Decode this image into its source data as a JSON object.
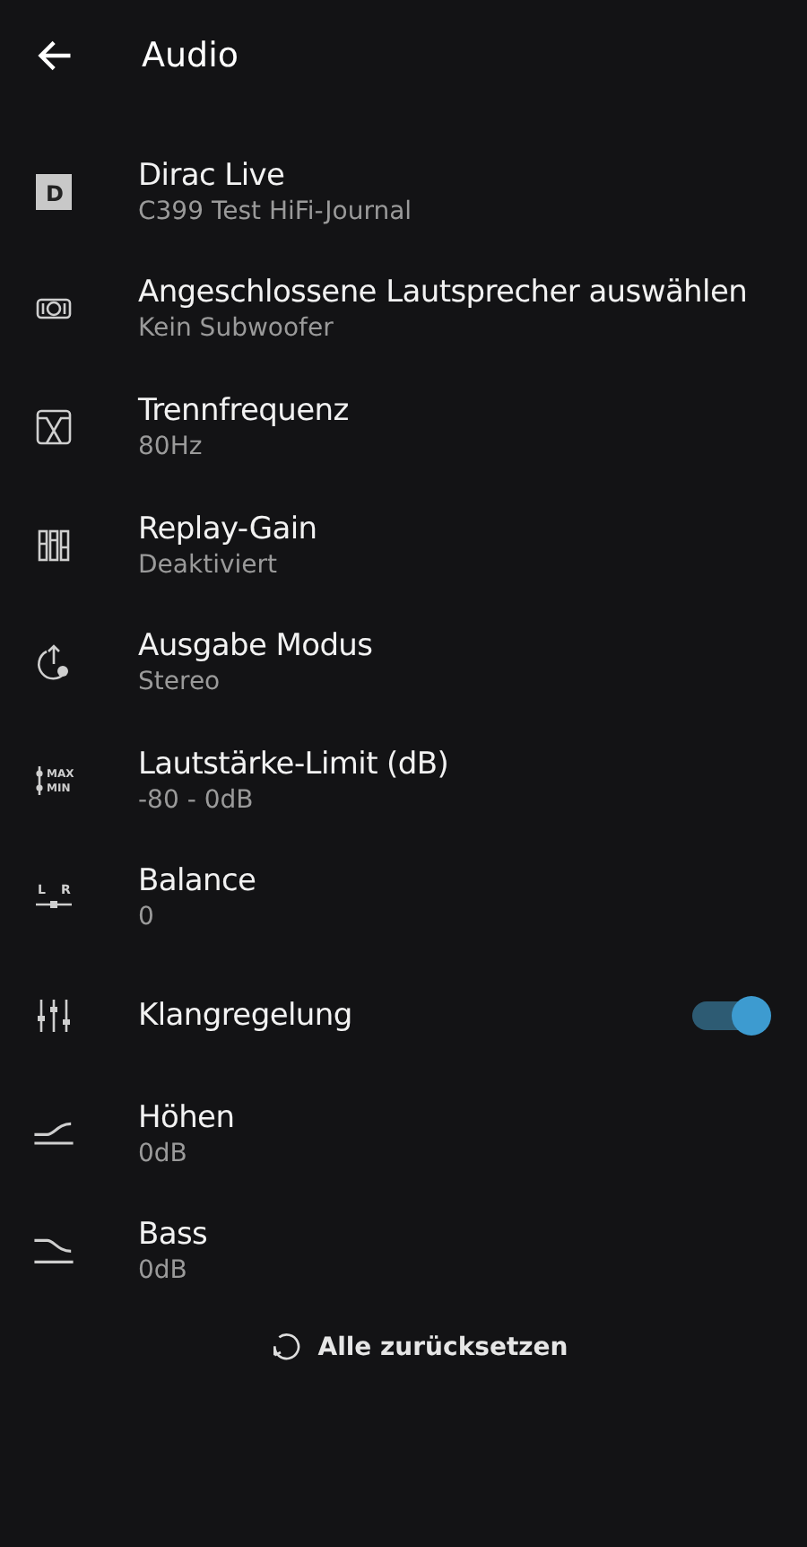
{
  "header": {
    "title": "Audio"
  },
  "items": [
    {
      "kind": "dirac",
      "icon_labels": [
        "D"
      ],
      "title": "Dirac Live",
      "subtitle": "C399 Test HiFi-Journal"
    },
    {
      "kind": "speakers",
      "title": "Angeschlossene Lautsprecher auswählen",
      "subtitle": "Kein Subwoofer"
    },
    {
      "kind": "crossover",
      "title": "Trennfrequenz",
      "subtitle": "80Hz"
    },
    {
      "kind": "replaygain",
      "title": "Replay-Gain",
      "subtitle": "Deaktiviert"
    },
    {
      "kind": "output",
      "title": "Ausgabe Modus",
      "subtitle": "Stereo"
    },
    {
      "kind": "limit",
      "icon_labels": [
        "MAX",
        "MIN"
      ],
      "title": "Lautstärke-Limit (dB)",
      "subtitle": "-80 - 0dB"
    },
    {
      "kind": "balance",
      "icon_labels": [
        "L",
        "R"
      ],
      "title": "Balance",
      "subtitle": "0"
    },
    {
      "kind": "equalizer",
      "title": "Klangregelung",
      "on": true
    },
    {
      "kind": "treble",
      "title": "Höhen",
      "subtitle": "0dB"
    },
    {
      "kind": "bass",
      "title": "Bass",
      "subtitle": "0dB"
    }
  ],
  "reset_button": {
    "label": "Alle zurücksetzen"
  }
}
